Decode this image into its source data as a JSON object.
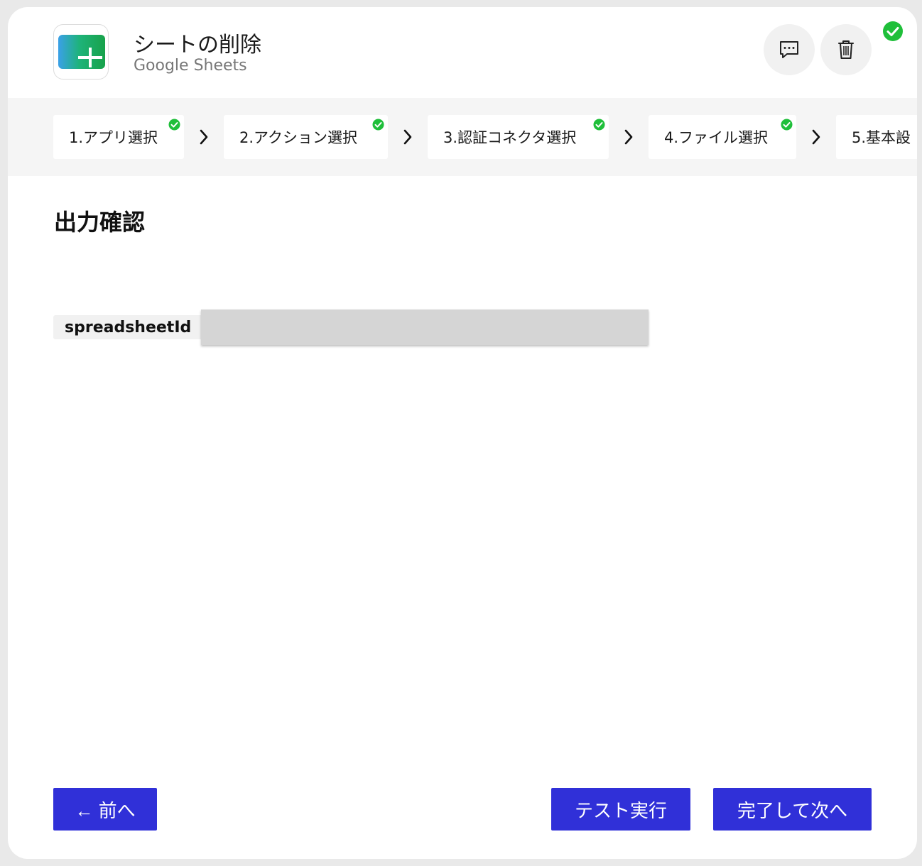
{
  "header": {
    "title": "シートの削除",
    "subtitle": "Google Sheets",
    "comment_icon": "comment-icon",
    "delete_icon": "trash-icon",
    "status_icon": "check-circle-icon"
  },
  "steps": [
    {
      "label": "1.アプリ選択",
      "done": true
    },
    {
      "label": "2.アクション選択",
      "done": true
    },
    {
      "label": "3.認証コネクタ選択",
      "done": true
    },
    {
      "label": "4.ファイル選択",
      "done": true
    },
    {
      "label": "5.基本設",
      "done": false
    }
  ],
  "main": {
    "section_title": "出力確認",
    "fields": [
      {
        "name": "spreadsheetId",
        "value": ""
      }
    ]
  },
  "footer": {
    "prev_label": "← 前へ",
    "test_label": "テスト実行",
    "next_label": "完了して次へ"
  },
  "colors": {
    "primary": "#3030d8",
    "success": "#1fbf3a",
    "app_green": "#1aa35a"
  }
}
